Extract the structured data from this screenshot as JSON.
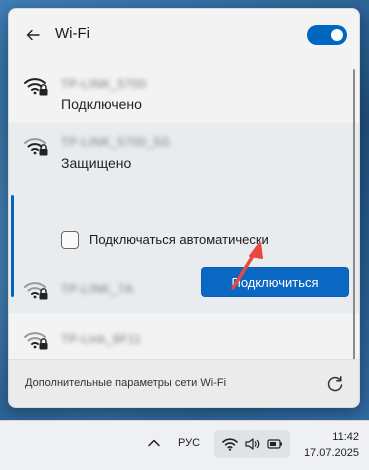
{
  "header": {
    "title": "Wi-Fi",
    "back_icon": "back-arrow-icon",
    "toggle_state": "on"
  },
  "networks": [
    {
      "ssid": "TP-LINK_5700",
      "status": "Подключено",
      "secured": true
    },
    {
      "ssid": "TP-LINK_5700_5G",
      "status": "Защищено",
      "secured": true
    },
    {
      "ssid": "TP-LINK_7A",
      "secured": true
    },
    {
      "ssid": "TP-Link_8F11",
      "secured": true
    }
  ],
  "selected": {
    "auto_connect_label": "Подключаться автоматически",
    "auto_connect_checked": false,
    "connect_button": "Подключиться"
  },
  "footer": {
    "settings_link": "Дополнительные параметры сети Wi-Fi",
    "refresh_icon": "refresh-icon"
  },
  "taskbar": {
    "language": "РУС",
    "time": "11:42",
    "date": "17.07.2025",
    "tray_icons": [
      "wifi-icon",
      "speaker-icon",
      "battery-icon"
    ]
  },
  "colors": {
    "accent": "#0067c0",
    "annotation_arrow": "#e8493f"
  }
}
